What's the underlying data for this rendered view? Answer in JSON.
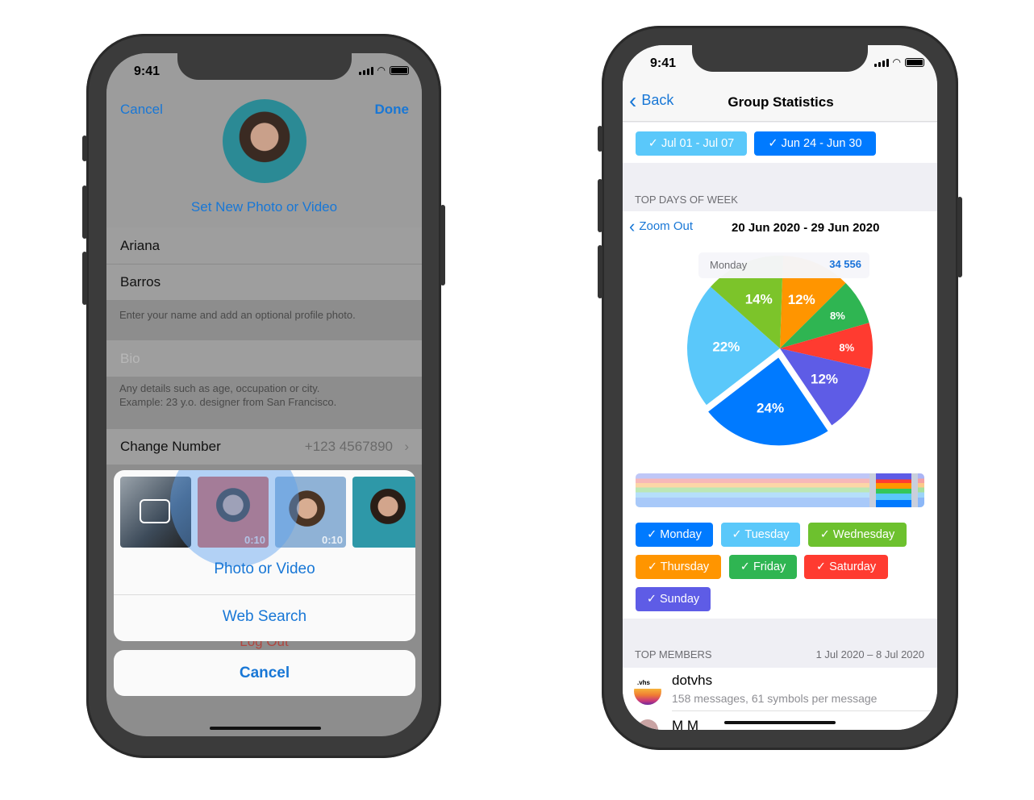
{
  "left_phone": {
    "status": {
      "time": "9:41"
    },
    "nav": {
      "cancel": "Cancel",
      "done": "Done"
    },
    "set_photo": "Set New Photo or Video",
    "first_name": "Ariana",
    "last_name": "Barros",
    "name_note": "Enter your name and add an optional profile photo.",
    "bio_placeholder": "Bio",
    "bio_note_1": "Any details such as age, occupation or city.",
    "bio_note_2": "Example: 23 y.o. designer from San Francisco.",
    "change_number": {
      "label": "Change Number",
      "value": "+123 4567890"
    },
    "log_out": "Log Out",
    "action_sheet": {
      "thumbnails": [
        {
          "duration": ""
        },
        {
          "duration": "0:10"
        },
        {
          "duration": "0:10"
        },
        {
          "duration": ""
        }
      ],
      "photo_or_video": "Photo or Video",
      "web_search": "Web Search",
      "cancel": "Cancel"
    }
  },
  "right_phone": {
    "status": {
      "time": "9:41"
    },
    "nav": {
      "back": "Back",
      "title": "Group Statistics"
    },
    "periods": [
      {
        "label": "✓ Jul 01 - Jul 07",
        "color": "#5ac8fa"
      },
      {
        "label": "✓ Jun 24 - Jun 30",
        "color": "#007aff"
      }
    ],
    "section_title": "TOP DAYS OF WEEK",
    "zoom_out": "Zoom Out",
    "date_range": "20 Jun 2020 - 29 Jun 2020",
    "tooltip": {
      "label": "Monday",
      "value": "34 556"
    },
    "day_chips": [
      {
        "label": "✓ Monday",
        "color": "#007aff"
      },
      {
        "label": "✓ Tuesday",
        "color": "#5ac8fa"
      },
      {
        "label": "✓ Wednesday",
        "color": "#6dc12e"
      },
      {
        "label": "✓ Thursday",
        "color": "#ff9500"
      },
      {
        "label": "✓ Friday",
        "color": "#2fb552"
      },
      {
        "label": "✓ Saturday",
        "color": "#ff3b30"
      },
      {
        "label": "✓ Sunday",
        "color": "#5e5ce6"
      }
    ],
    "members_title": "TOP MEMBERS",
    "members_range": "1 Jul 2020 – 8 Jul 2020",
    "members": [
      {
        "name": "dotvhs",
        "avatar_text": ".vhs",
        "detail": "158 messages, 61 symbols per message"
      },
      {
        "name": "M M",
        "detail": ""
      }
    ]
  },
  "chart_data": {
    "type": "pie",
    "categories": [
      "Thursday",
      "Friday",
      "Saturday",
      "Sunday",
      "Monday",
      "Tuesday",
      "Wednesday"
    ],
    "values": [
      12,
      8,
      8,
      12,
      24,
      22,
      14
    ],
    "labels": [
      "12%",
      "8%",
      "8%",
      "12%",
      "24%",
      "22%",
      "14%"
    ],
    "colors": [
      "#ff9500",
      "#2fb552",
      "#ff3b30",
      "#5e5ce6",
      "#007aff",
      "#5ac8fa",
      "#7cc42a"
    ],
    "highlighted": "Monday"
  }
}
